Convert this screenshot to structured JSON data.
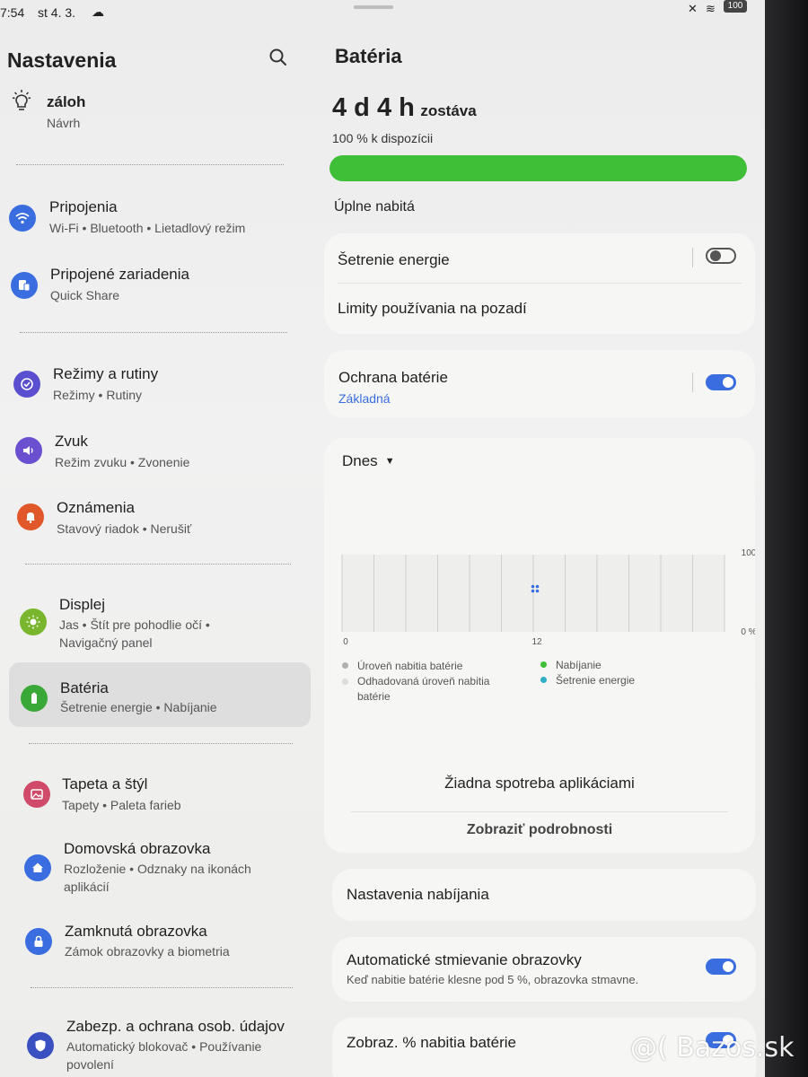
{
  "status_bar": {
    "time": "7:54",
    "date": "st 4. 3.",
    "battery": "100"
  },
  "left_pane": {
    "title": "Nastavenia",
    "suggestion": {
      "title": "záloh",
      "subtitle": "Návrh"
    },
    "items": [
      {
        "label": "Pripojenia",
        "sub": "Wi-Fi • Bluetooth • Lietadlový režim",
        "icon": "wifi-icon",
        "color": "#3a6ee0"
      },
      {
        "label": "Pripojené zariadenia",
        "sub": "Quick Share",
        "icon": "devices-icon",
        "color": "#3a6ee0"
      },
      {
        "label": "Režimy a rutiny",
        "sub": "Režimy • Rutiny",
        "icon": "check-circle-icon",
        "color": "#5a4fcf"
      },
      {
        "label": "Zvuk",
        "sub": "Režim zvuku • Zvonenie",
        "icon": "speaker-icon",
        "color": "#6a4fcf"
      },
      {
        "label": "Oznámenia",
        "sub": "Stavový riadok • Nerušiť",
        "icon": "bell-icon",
        "color": "#e0582a"
      },
      {
        "label": "Displej",
        "sub": "Jas • Štít pre pohodlie očí • Navigačný panel",
        "icon": "sun-icon",
        "color": "#7ab62d"
      },
      {
        "label": "Batéria",
        "sub": "Šetrenie energie • Nabíjanie",
        "icon": "battery-icon",
        "color": "#3aa838"
      },
      {
        "label": "Tapeta a štýl",
        "sub": "Tapety • Paleta farieb",
        "icon": "image-icon",
        "color": "#d04a6a"
      },
      {
        "label": "Domovská obrazovka",
        "sub": "Rozloženie • Odznaky na ikonách aplikácií",
        "icon": "home-icon",
        "color": "#3a6ee0"
      },
      {
        "label": "Zamknutá obrazovka",
        "sub": "Zámok obrazovky a biometria",
        "icon": "lock-icon",
        "color": "#3a6ee0"
      },
      {
        "label": "Zabezp. a ochrana osob. údajov",
        "sub": "Automatický blokovač • Používanie povolení",
        "icon": "shield-icon",
        "color": "#3a4fc0"
      }
    ]
  },
  "right_pane": {
    "title": "Batéria",
    "remaining_value": "4 d 4 h",
    "remaining_label": "zostáva",
    "available": "100 % k dispozícii",
    "battery_level": 1.0,
    "charge_status": "Úplne nabitá",
    "power_saving": {
      "label": "Šetrenie energie",
      "enabled": false
    },
    "background_limits": "Limity používania na pozadí",
    "battery_protection": {
      "label": "Ochrana batérie",
      "sub": "Základná",
      "enabled": true
    },
    "usage_period": "Dnes",
    "chart_data": {
      "type": "line",
      "x_ticks": [
        "0",
        "12"
      ],
      "y_ticks": [
        "100",
        "0 %"
      ],
      "series": [],
      "legend": [
        {
          "label": "Úroveň nabitia batérie",
          "color": "#b0b0b0"
        },
        {
          "label": "Odhadovaná úroveň nabitia batérie",
          "color": "#dcdcdc"
        },
        {
          "label": "Nabíjanie",
          "color": "#3fbf38"
        },
        {
          "label": "Šetrenie energie",
          "color": "#2fb0c8"
        }
      ]
    },
    "no_usage": "Žiadna spotreba aplikáciami",
    "show_details": "Zobraziť podrobnosti",
    "charging_settings": "Nastavenia nabíjania",
    "auto_dim": {
      "label": "Automatické stmievanie obrazovky",
      "sub": "Keď nabitie batérie klesne pod 5 %, obrazovka stmavne.",
      "enabled": true
    },
    "show_percentage": {
      "label": "Zobraz. % nabitia batérie",
      "enabled": true
    }
  },
  "watermark": "@( Bazos.sk"
}
